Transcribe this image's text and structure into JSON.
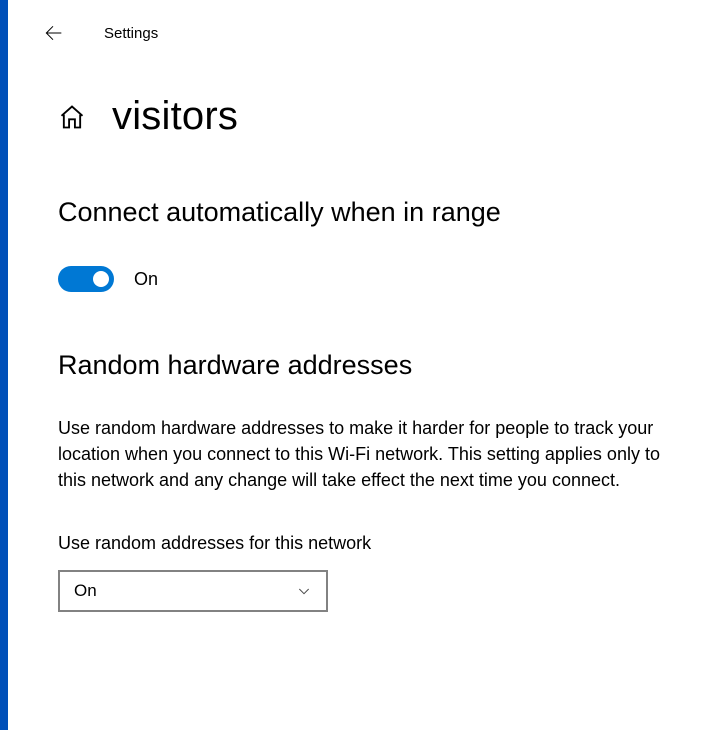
{
  "header": {
    "title": "Settings"
  },
  "page": {
    "title": "visitors"
  },
  "sections": {
    "auto_connect": {
      "heading": "Connect automatically when in range",
      "toggle_state": "On"
    },
    "random_hw": {
      "heading": "Random hardware addresses",
      "description": "Use random hardware addresses to make it harder for people to track your location when you connect to this Wi-Fi network. This setting applies only to this network and any change will take effect the next time you connect.",
      "dropdown_label": "Use random addresses for this network",
      "dropdown_value": "On"
    }
  }
}
